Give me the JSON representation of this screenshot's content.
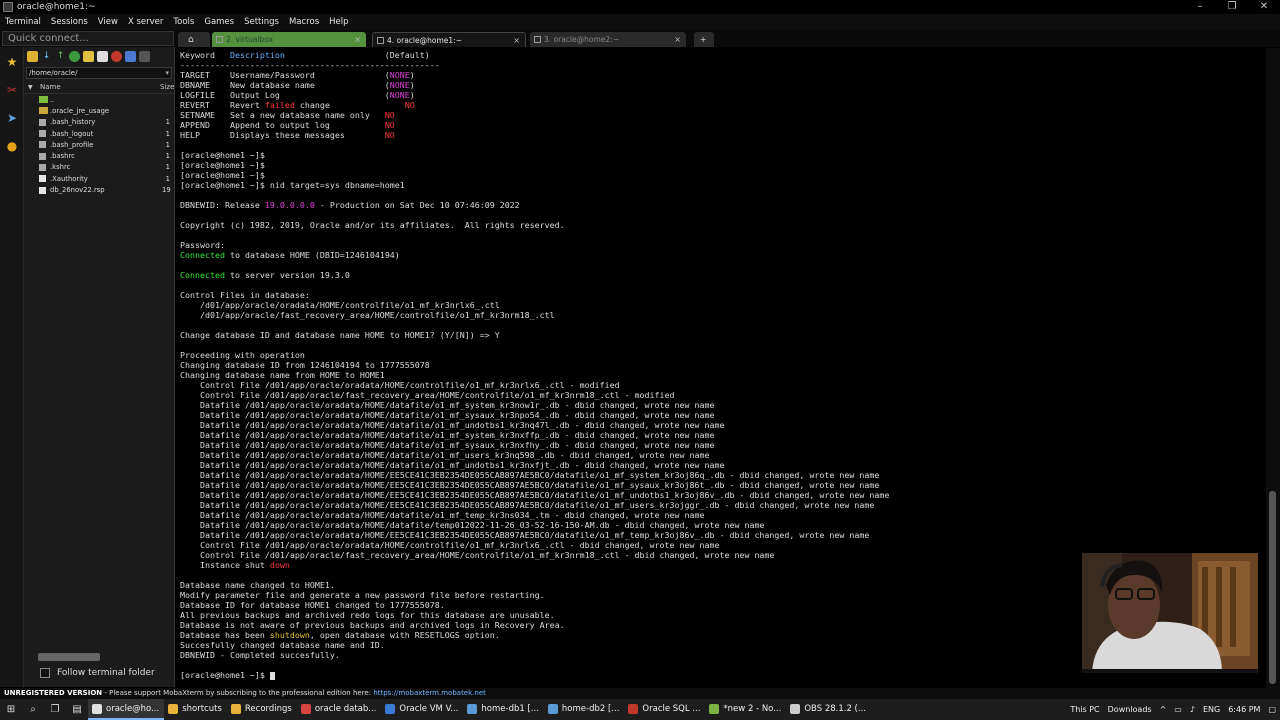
{
  "window": {
    "title": "oracle@home1:~",
    "controls": [
      "–",
      "❐",
      "✕"
    ]
  },
  "menu": [
    "Terminal",
    "Sessions",
    "View",
    "X server",
    "Tools",
    "Games",
    "Settings",
    "Macros",
    "Help"
  ],
  "quick_connect": {
    "placeholder": "Quick connect..."
  },
  "tabs": [
    {
      "label": "2. virtualbox"
    },
    {
      "label": "4. oracle@home1:~"
    },
    {
      "label": "3. oracle@home2:~"
    }
  ],
  "sidebar": {
    "path": "/home/oracle/",
    "columns": {
      "name": "Name",
      "size": "Size"
    },
    "files": [
      {
        "name": "..",
        "size": "",
        "kind": "folder-up"
      },
      {
        "name": ".oracle_jre_usage",
        "size": "",
        "kind": "folder"
      },
      {
        "name": ".bash_history",
        "size": "1",
        "kind": "file"
      },
      {
        "name": ".bash_logout",
        "size": "1",
        "kind": "file"
      },
      {
        "name": ".bash_profile",
        "size": "1",
        "kind": "file"
      },
      {
        "name": ".bashrc",
        "size": "1",
        "kind": "file"
      },
      {
        "name": ".kshrc",
        "size": "1",
        "kind": "file"
      },
      {
        "name": ".Xauthority",
        "size": "1",
        "kind": "fileA"
      },
      {
        "name": "db_26nov22.rsp",
        "size": "19",
        "kind": "fileA"
      }
    ],
    "follow_label": "Follow terminal folder"
  },
  "terminal": {
    "lines": [
      [
        {
          "t": "Keyword   "
        },
        {
          "t": "Description",
          "c": "blue"
        },
        {
          "t": "                    (Default)"
        }
      ],
      [
        {
          "t": "----------------------------------------------------"
        }
      ],
      [
        {
          "t": "TARGET    Username/Password              ("
        },
        {
          "t": "NONE",
          "c": "mag"
        },
        {
          "t": ")"
        }
      ],
      [
        {
          "t": "DBNAME    New database name              ("
        },
        {
          "t": "NONE",
          "c": "mag"
        },
        {
          "t": ")"
        }
      ],
      [
        {
          "t": "LOGFILE   Output Log                     ("
        },
        {
          "t": "NONE",
          "c": "mag"
        },
        {
          "t": ")"
        }
      ],
      [
        {
          "t": "REVERT    Revert "
        },
        {
          "t": "failed",
          "c": "red"
        },
        {
          "t": " change               "
        },
        {
          "t": "NO",
          "c": "red"
        }
      ],
      [
        {
          "t": "SETNAME   Set a new database name only   "
        },
        {
          "t": "NO",
          "c": "red"
        }
      ],
      [
        {
          "t": "APPEND    Append to output log           "
        },
        {
          "t": "NO",
          "c": "red"
        }
      ],
      [
        {
          "t": "HELP      Displays these messages        "
        },
        {
          "t": "NO",
          "c": "red"
        }
      ],
      [
        {
          "t": ""
        }
      ],
      [
        {
          "t": "[oracle@home1 ~]$"
        }
      ],
      [
        {
          "t": "[oracle@home1 ~]$"
        }
      ],
      [
        {
          "t": "[oracle@home1 ~]$"
        }
      ],
      [
        {
          "t": "[oracle@home1 ~]$ nid target=sys dbname=home1"
        }
      ],
      [
        {
          "t": ""
        }
      ],
      [
        {
          "t": "DBNEWID: Release "
        },
        {
          "t": "19.0.0.0.0",
          "c": "mag"
        },
        {
          "t": " - Production on Sat Dec 10 07:46:09 2022"
        }
      ],
      [
        {
          "t": ""
        }
      ],
      [
        {
          "t": "Copyright (c) 1982, 2019, Oracle and/or its affiliates.  All rights reserved."
        }
      ],
      [
        {
          "t": ""
        }
      ],
      [
        {
          "t": "Password:"
        }
      ],
      [
        {
          "t": "Connected",
          "c": "green"
        },
        {
          "t": " to database HOME (DBID=1246104194)"
        }
      ],
      [
        {
          "t": ""
        }
      ],
      [
        {
          "t": "Connected",
          "c": "green"
        },
        {
          "t": " to server version 19.3.0"
        }
      ],
      [
        {
          "t": ""
        }
      ],
      [
        {
          "t": "Control Files in database:"
        }
      ],
      [
        {
          "t": "    /d01/app/oracle/oradata/HOME/controlfile/o1_mf_kr3nrlx6_.ctl"
        }
      ],
      [
        {
          "t": "    /d01/app/oracle/fast_recovery_area/HOME/controlfile/o1_mf_kr3nrm18_.ctl"
        }
      ],
      [
        {
          "t": ""
        }
      ],
      [
        {
          "t": "Change database ID and database name HOME to HOME1? (Y/[N]) => Y"
        }
      ],
      [
        {
          "t": ""
        }
      ],
      [
        {
          "t": "Proceeding with operation"
        }
      ],
      [
        {
          "t": "Changing database ID from 1246104194 to 1777555078"
        }
      ],
      [
        {
          "t": "Changing database name from HOME to HOME1"
        }
      ],
      [
        {
          "t": "    Control File /d01/app/oracle/oradata/HOME/controlfile/o1_mf_kr3nrlx6_.ctl - modified"
        }
      ],
      [
        {
          "t": "    Control File /d01/app/oracle/fast_recovery_area/HOME/controlfile/o1_mf_kr3nrm18_.ctl - modified"
        }
      ],
      [
        {
          "t": "    Datafile /d01/app/oracle/oradata/HOME/datafile/o1_mf_system_kr3now1r_.db - dbid changed, wrote new name"
        }
      ],
      [
        {
          "t": "    Datafile /d01/app/oracle/oradata/HOME/datafile/o1_mf_sysaux_kr3npo54_.db - dbid changed, wrote new name"
        }
      ],
      [
        {
          "t": "    Datafile /d01/app/oracle/oradata/HOME/datafile/o1_mf_undotbs1_kr3nq47l_.db - dbid changed, wrote new name"
        }
      ],
      [
        {
          "t": "    Datafile /d01/app/oracle/oradata/HOME/datafile/o1_mf_system_kr3nxffp_.db - dbid changed, wrote new name"
        }
      ],
      [
        {
          "t": "    Datafile /d01/app/oracle/oradata/HOME/datafile/o1_mf_sysaux_kr3nxfhy_.db - dbid changed, wrote new name"
        }
      ],
      [
        {
          "t": "    Datafile /d01/app/oracle/oradata/HOME/datafile/o1_mf_users_kr3nq598_.db - dbid changed, wrote new name"
        }
      ],
      [
        {
          "t": "    Datafile /d01/app/oracle/oradata/HOME/datafile/o1_mf_undotbs1_kr3nxfjt_.db - dbid changed, wrote new name"
        }
      ],
      [
        {
          "t": "    Datafile /d01/app/oracle/oradata/HOME/EE5CE41C3EB2354DE055CAB897AE5BC0/datafile/o1_mf_system_kr3oj86q_.db - dbid changed, wrote new name"
        }
      ],
      [
        {
          "t": "    Datafile /d01/app/oracle/oradata/HOME/EE5CE41C3EB2354DE055CAB897AE5BC0/datafile/o1_mf_sysaux_kr3oj86t_.db - dbid changed, wrote new name"
        }
      ],
      [
        {
          "t": "    Datafile /d01/app/oracle/oradata/HOME/EE5CE41C3EB2354DE055CAB897AE5BC0/datafile/o1_mf_undotbs1_kr3oj86v_.db - dbid changed, wrote new name"
        }
      ],
      [
        {
          "t": "    Datafile /d01/app/oracle/oradata/HOME/EE5CE41C3EB2354DE055CAB897AE5BC0/datafile/o1_mf_users_kr3ojggr_.db - dbid changed, wrote new name"
        }
      ],
      [
        {
          "t": "    Datafile /d01/app/oracle/oradata/HOME/datafile/o1_mf_temp_kr3ns034_.tm - dbid changed, wrote new name"
        }
      ],
      [
        {
          "t": "    Datafile /d01/app/oracle/oradata/HOME/datafile/temp012022-11-26_03-52-16-150-AM.db - dbid changed, wrote new name"
        }
      ],
      [
        {
          "t": "    Datafile /d01/app/oracle/oradata/HOME/EE5CE41C3EB2354DE055CAB897AE5BC0/datafile/o1_mf_temp_kr3oj86v_.db - dbid changed, wrote new name"
        }
      ],
      [
        {
          "t": "    Control File /d01/app/oracle/oradata/HOME/controlfile/o1_mf_kr3nrlx6_.ctl - dbid changed, wrote new name"
        }
      ],
      [
        {
          "t": "    Control File /d01/app/oracle/fast_recovery_area/HOME/controlfile/o1_mf_kr3nrm18_.ctl - dbid changed, wrote new name"
        }
      ],
      [
        {
          "t": "    Instance shut "
        },
        {
          "t": "down",
          "c": "red"
        }
      ],
      [
        {
          "t": ""
        }
      ],
      [
        {
          "t": "Database name changed to HOME1."
        }
      ],
      [
        {
          "t": "Modify parameter file and generate a new password file before restarting."
        }
      ],
      [
        {
          "t": "Database ID for database HOME1 changed to 1777555078."
        }
      ],
      [
        {
          "t": "All previous backups and archived redo logs for this database are unusable."
        }
      ],
      [
        {
          "t": "Database is not aware of previous backups and archived logs in Recovery Area."
        }
      ],
      [
        {
          "t": "Database has been "
        },
        {
          "t": "shutdown",
          "c": "yellow"
        },
        {
          "t": ", open database with RESETLOGS option."
        }
      ],
      [
        {
          "t": "Succesfully changed database name and ID."
        }
      ],
      [
        {
          "t": "DBNEWID - Completed succesfully."
        }
      ],
      [
        {
          "t": ""
        }
      ],
      [
        {
          "t": "[oracle@home1 ~]$ "
        },
        {
          "t": "",
          "c": "cursor"
        }
      ]
    ]
  },
  "banner": {
    "label": "UNREGISTERED VERSION",
    "text": "  -  Please support MobaXterm by subscribing to the professional edition here:",
    "link": "https://mobaxterm.mobatek.net"
  },
  "taskbar": {
    "apps": [
      {
        "label": "oracle@ho...",
        "color": "#e0e0e0",
        "active": true
      },
      {
        "label": "shortcuts",
        "color": "#e8b23a",
        "active": false
      },
      {
        "label": "Recordings",
        "color": "#e8b23a",
        "active": false
      },
      {
        "label": "oracle datab...",
        "color": "#d64541",
        "active": false
      },
      {
        "label": "Oracle VM V...",
        "color": "#3a7bd5",
        "active": false
      },
      {
        "label": "home-db1 [...",
        "color": "#5a9bd5",
        "active": false
      },
      {
        "label": "home-db2 [...",
        "color": "#5a9bd5",
        "active": false
      },
      {
        "label": "Oracle SQL ...",
        "color": "#c0392b",
        "active": false
      },
      {
        "label": "*new 2 - No...",
        "color": "#7cb342",
        "active": false
      },
      {
        "label": "OBS 28.1.2 (...",
        "color": "#cccccc",
        "active": false
      }
    ],
    "tray": {
      "this_pc": "This PC",
      "downloads": "Downloads",
      "lang": "ENG",
      "time": "6:46 PM"
    }
  }
}
